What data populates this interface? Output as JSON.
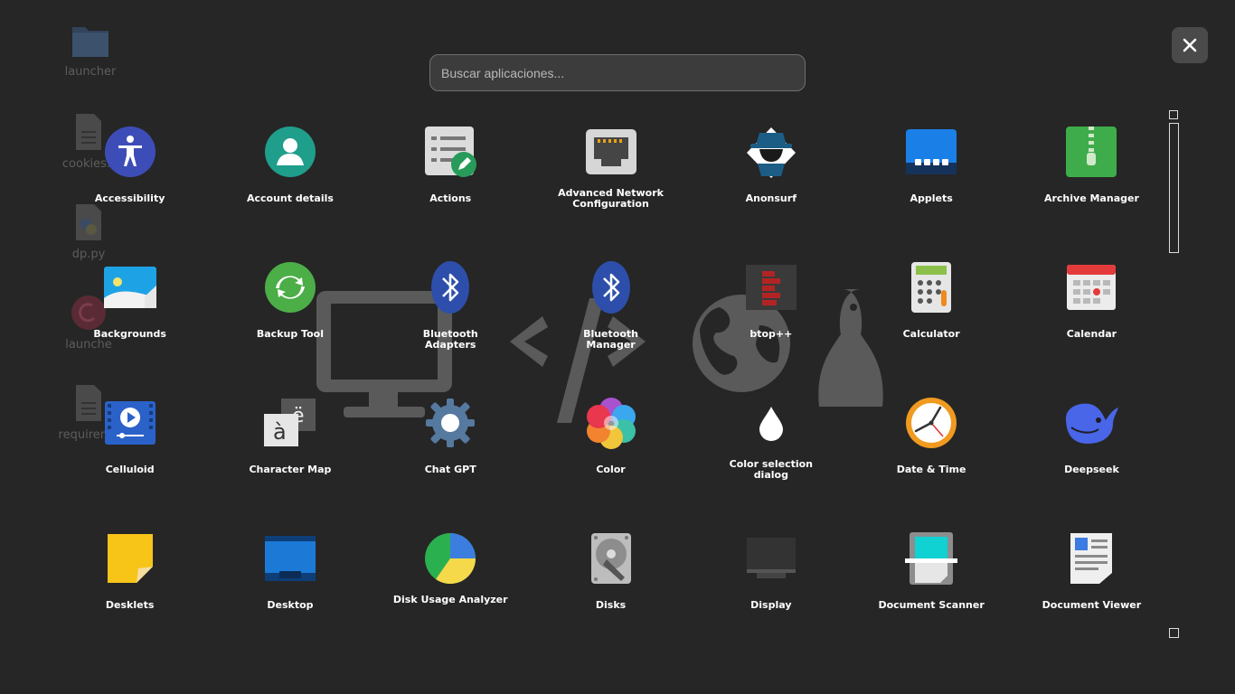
{
  "desktop": {
    "items": [
      {
        "label": "launcher",
        "icon": "folder-icon"
      },
      {
        "label": "cookies.t",
        "icon": "text-file-icon"
      },
      {
        "label": "dp.py",
        "icon": "python-file-icon"
      },
      {
        "label": "launche",
        "icon": "debian-icon"
      },
      {
        "label": "requireme",
        "icon": "text-file-icon"
      }
    ]
  },
  "search": {
    "placeholder": "Buscar aplicaciones..."
  },
  "close": {
    "icon": "close-icon"
  },
  "apps": [
    {
      "label": "Accessibility",
      "icon": "accessibility-icon"
    },
    {
      "label": "Account details",
      "icon": "account-icon"
    },
    {
      "label": "Actions",
      "icon": "actions-icon"
    },
    {
      "label": "Advanced Network Configuration",
      "icon": "network-port-icon"
    },
    {
      "label": "Anonsurf",
      "icon": "anonsurf-icon"
    },
    {
      "label": "Applets",
      "icon": "applets-icon"
    },
    {
      "label": "Archive Manager",
      "icon": "archive-icon"
    },
    {
      "label": "Backgrounds",
      "icon": "backgrounds-icon"
    },
    {
      "label": "Backup Tool",
      "icon": "backup-icon"
    },
    {
      "label": "Bluetooth Adapters",
      "icon": "bluetooth-icon"
    },
    {
      "label": "Bluetooth Manager",
      "icon": "bluetooth-icon"
    },
    {
      "label": "btop++",
      "icon": "btop-icon"
    },
    {
      "label": "Calculator",
      "icon": "calculator-icon"
    },
    {
      "label": "Calendar",
      "icon": "calendar-icon"
    },
    {
      "label": "Celluloid",
      "icon": "video-player-icon"
    },
    {
      "label": "Character Map",
      "icon": "character-map-icon"
    },
    {
      "label": "Chat GPT",
      "icon": "gear-icon"
    },
    {
      "label": "Color",
      "icon": "color-icon"
    },
    {
      "label": "Color selection dialog",
      "icon": "drop-icon"
    },
    {
      "label": "Date & Time",
      "icon": "clock-icon"
    },
    {
      "label": "Deepseek",
      "icon": "whale-icon"
    },
    {
      "label": "Desklets",
      "icon": "sticky-note-icon"
    },
    {
      "label": "Desktop",
      "icon": "desktop-icon"
    },
    {
      "label": "Disk Usage Analyzer",
      "icon": "pie-chart-icon"
    },
    {
      "label": "Disks",
      "icon": "disk-icon"
    },
    {
      "label": "Display",
      "icon": "display-icon"
    },
    {
      "label": "Document Scanner",
      "icon": "scanner-icon"
    },
    {
      "label": "Document Viewer",
      "icon": "document-icon"
    }
  ]
}
